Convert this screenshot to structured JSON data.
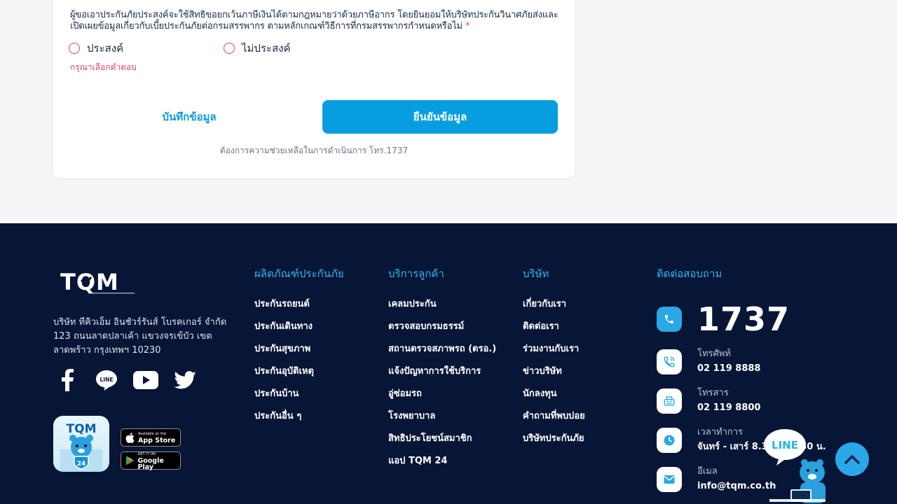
{
  "form": {
    "question": "ผู้ขอเอาประกันภัยประสงค์จะใช้สิทธิขอยกเว้นภาษีเงินได้ตามกฎหมายว่าด้วยภาษีอากร โดยยินยอมให้บริษัทประกันวินาศภัยส่งและเปิดเผยข้อมูลเกี่ยวกับเบี้ยประกันภัยต่อกรมสรรพากร ตามหลักเกณฑ์วิธีการที่กรมสรรพากรกำหนดหรือไม่",
    "required_mark": "*",
    "option_yes": "ประสงค์",
    "option_no": "ไม่ประสงค์",
    "error": "กรุณาเลือกคำตอบ",
    "save_label": "บันทึกข้อมูล",
    "confirm_label": "ยืนยันข้อมูล",
    "help": "ต้องการความช่วยเหลือในการดำเนินการ โทร.1737"
  },
  "footer": {
    "company": "บริษัท ทีคิวเอ็ม อินชัวร์รันส์ โบรคเกอร์ จำกัด",
    "address_line": "123 ถนนลาดปลาเค้า แขวงจรเข้บัว เขตลาดพร้าว กรุงเทพฯ 10230",
    "app_store": {
      "small": "Available on the",
      "big": "App Store"
    },
    "google_play": {
      "small": "GET IT ON",
      "big": "Google Play"
    },
    "columns": [
      {
        "title": "ผลิตภัณฑ์ประกันภัย",
        "links": [
          "ประกันรถยนต์",
          "ประกันเดินทาง",
          "ประกันสุขภาพ",
          "ประกันอุบัติเหตุ",
          "ประกันบ้าน",
          "ประกันอื่น ๆ"
        ]
      },
      {
        "title": "บริการลูกค้า",
        "links": [
          "เคลมประกัน",
          "ตรวจสอบกรมธรรม์",
          "สถานตรวจสภาพรถ (ตรอ.)",
          "แจ้งปัญหาการใช้บริการ",
          "อู่ซ่อมรถ",
          "โรงพยาบาล",
          "สิทธิประโยชน์สมาชิก",
          "แอป TQM 24"
        ]
      },
      {
        "title": "บริษัท",
        "links": [
          "เกี่ยวกับเรา",
          "ติดต่อเรา",
          "ร่วมงานกับเรา",
          "ข่าวบริษัท",
          "นักลงทุน",
          "คำถามที่พบบ่อย",
          "บริษัทประกันภัย"
        ]
      }
    ],
    "contact": {
      "title": "ติดต่อสอบถาม",
      "hotline": "1737",
      "phone_label": "โทรศัพท์",
      "phone": "02 119 8888",
      "fax_label": "โทรสาร",
      "fax": "02 119 8800",
      "hours_label": "เวลาทำการ",
      "hours": "จันทร์ - เสาร์ 8.30 - 17.30 น.",
      "email_label": "อีเมล",
      "email": "info@tqm.co.th"
    },
    "line_label": "LINE",
    "brand_logo": "TQM",
    "app_logo": "TQM",
    "app_badge": "24"
  },
  "colors": {
    "accent": "#069ee0",
    "footer_bg": "#071536",
    "error": "#e0455a",
    "link_title": "#33b4ee"
  }
}
